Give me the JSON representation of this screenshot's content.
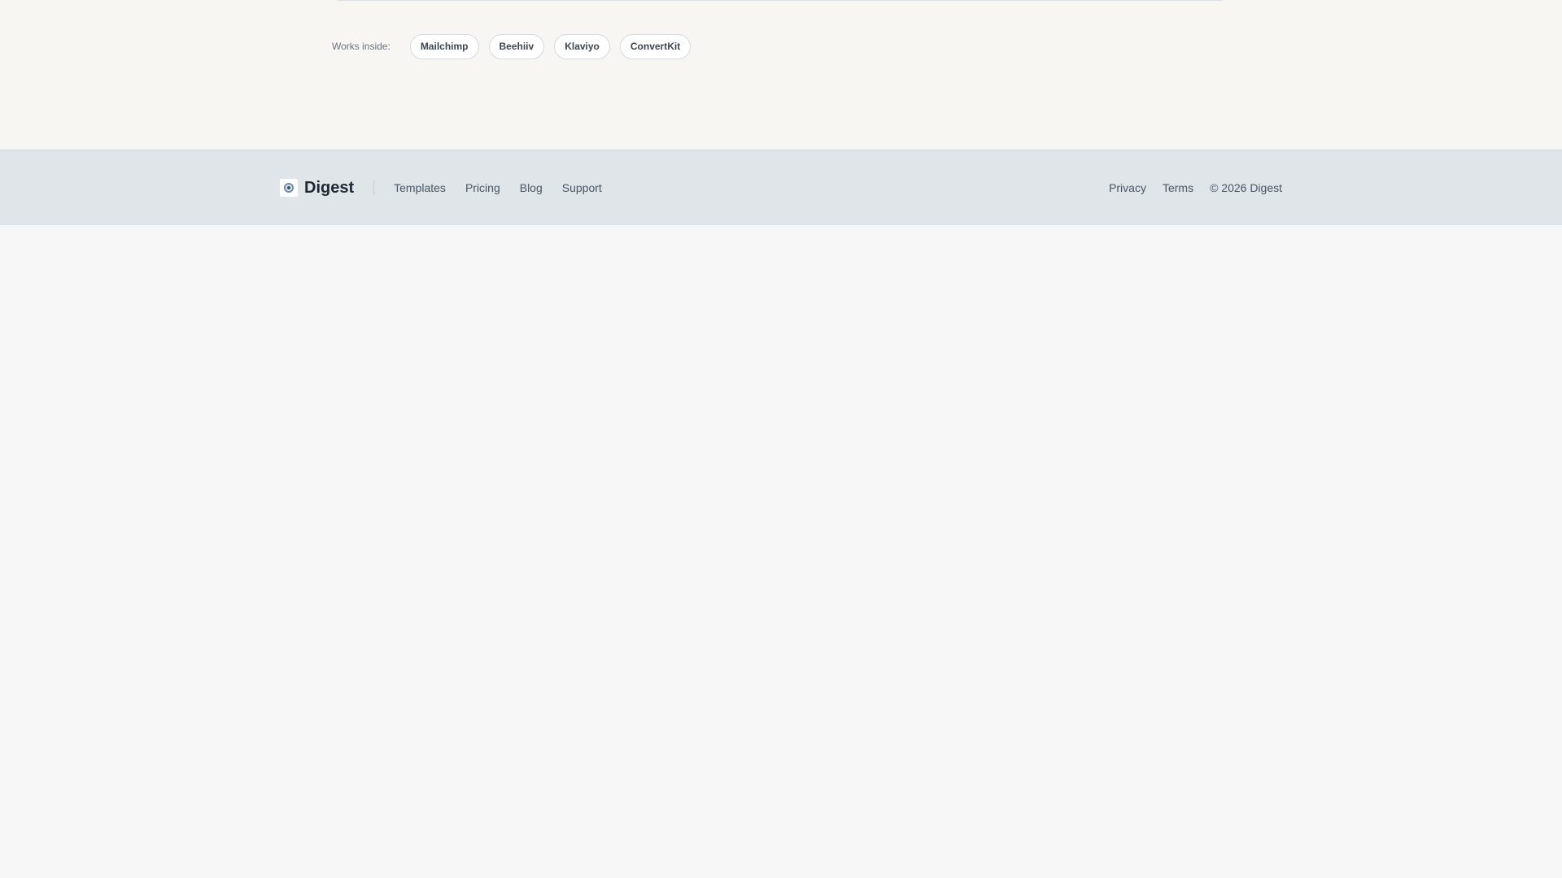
{
  "integrations": {
    "label": "Works inside:",
    "items": [
      "Mailchimp",
      "Beehiiv",
      "Klaviyo",
      "ConvertKit"
    ]
  },
  "footer": {
    "brand": "Digest",
    "nav": [
      "Templates",
      "Pricing",
      "Blog",
      "Support"
    ],
    "links": [
      "Privacy",
      "Terms"
    ],
    "copyright": "© 2026 Digest",
    "logo_icon": "digest-logo-icon"
  },
  "colors": {
    "hero_background": "#f7f6f2",
    "footer_background": "#dfe5e9",
    "page_background": "#f7f7f7"
  }
}
